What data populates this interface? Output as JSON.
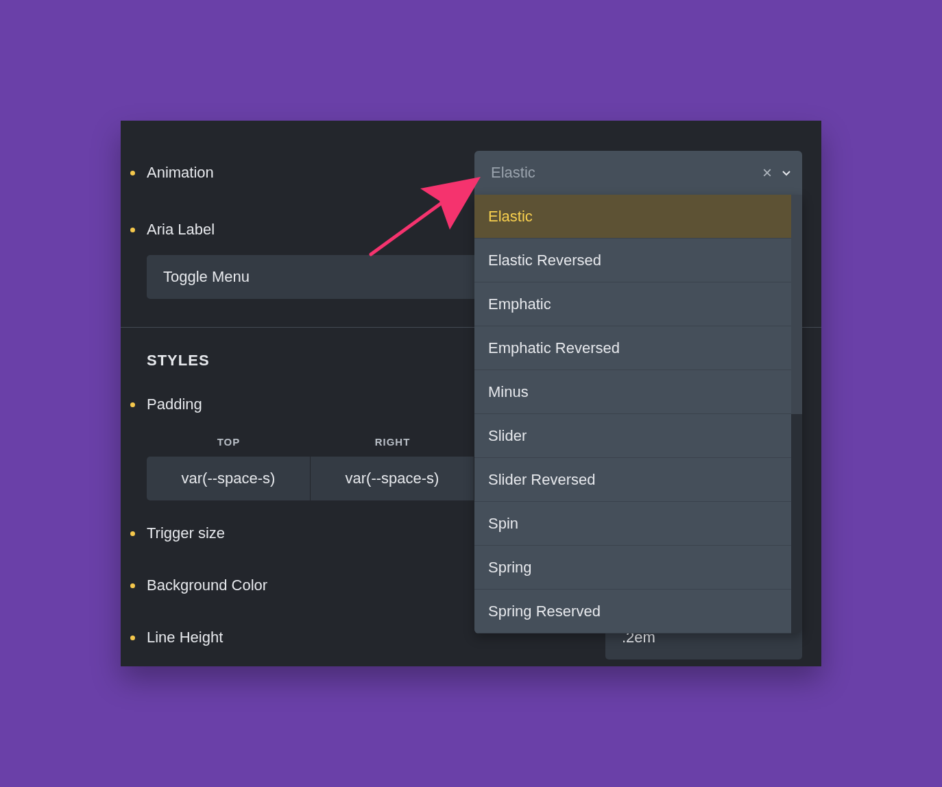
{
  "animation": {
    "label": "Animation",
    "value": "Elastic",
    "clear_icon": "×",
    "expanded": true,
    "options": [
      {
        "label": "Elastic",
        "selected": true
      },
      {
        "label": "Elastic Reversed",
        "selected": false
      },
      {
        "label": "Emphatic",
        "selected": false
      },
      {
        "label": "Emphatic Reversed",
        "selected": false
      },
      {
        "label": "Minus",
        "selected": false
      },
      {
        "label": "Slider",
        "selected": false
      },
      {
        "label": "Slider Reversed",
        "selected": false
      },
      {
        "label": "Spin",
        "selected": false
      },
      {
        "label": "Spring",
        "selected": false
      },
      {
        "label": "Spring Reserved",
        "selected": false
      }
    ]
  },
  "aria_label": {
    "label": "Aria Label",
    "value": "Toggle Menu"
  },
  "styles": {
    "title": "STYLES",
    "padding": {
      "label": "Padding",
      "sides": [
        {
          "label": "TOP",
          "value": "var(--space-s)"
        },
        {
          "label": "RIGHT",
          "value": "var(--space-s)"
        }
      ]
    },
    "trigger_size": {
      "label": "Trigger size"
    },
    "background_color": {
      "label": "Background Color"
    },
    "line_height": {
      "label": "Line Height",
      "value": ".2em"
    }
  }
}
